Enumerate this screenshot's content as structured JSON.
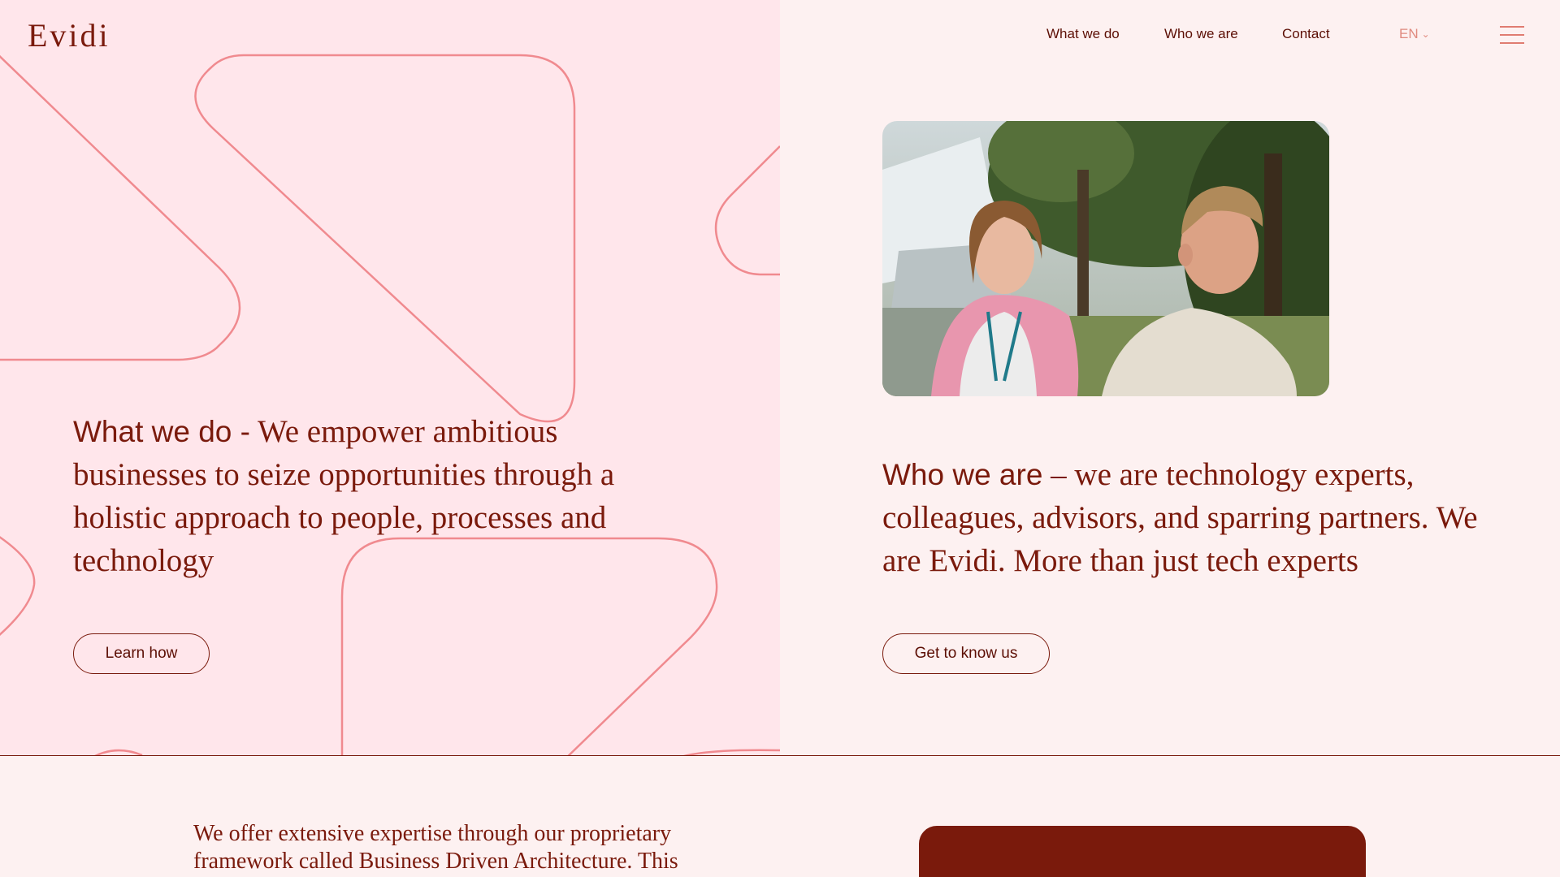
{
  "brand": {
    "logo_text": "Evidi"
  },
  "nav": {
    "items": [
      {
        "label": "What we do"
      },
      {
        "label": "Who we are"
      },
      {
        "label": "Contact"
      }
    ],
    "language": "EN",
    "menu_icon": "hamburger-menu-icon"
  },
  "what_we_do": {
    "lead": "What we do -",
    "body": " We empower ambitious businesses to seize opportunities through a holistic approach to people, processes and technology",
    "cta": "Learn how"
  },
  "who_we_are": {
    "lead": "Who we are",
    "body": " – we are technology experts, colleagues, advisors, and sparring partners. We are Evidi. More than just tech experts",
    "cta": "Get to know us"
  },
  "intro": {
    "text": "We offer extensive expertise through our proprietary framework called Business Driven Architecture. This"
  },
  "colors": {
    "primary": "#7a1a0c",
    "left_panel_bg": "#ffe6eb",
    "page_bg": "#fdf1f1",
    "deco_stroke": "#f08a8f",
    "lang_color": "#e08a7f"
  }
}
